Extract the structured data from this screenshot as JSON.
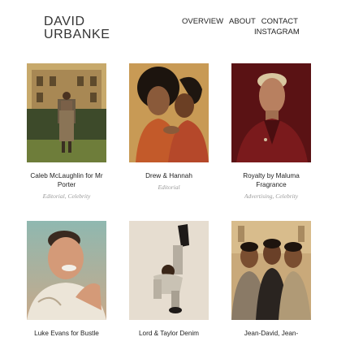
{
  "header": {
    "logo_line1": "DAVID",
    "logo_line2": "URBANKE"
  },
  "nav": {
    "overview": "OVERVIEW",
    "about": "ABOUT",
    "contact": "CONTACT",
    "instagram": "INSTAGRAM"
  },
  "projects": [
    {
      "title": "Caleb McLaughlin for Mr Porter",
      "tags": "Editorial, Celebrity"
    },
    {
      "title": "Drew & Hannah",
      "tags": "Editorial"
    },
    {
      "title": "Royalty by Maluma Fragrance",
      "tags": "Advertising, Celebrity"
    },
    {
      "title": "Luke Evans for Bustle",
      "tags": ""
    },
    {
      "title": "Lord & Taylor Denim",
      "tags": ""
    },
    {
      "title": "Jean-David, Jean-",
      "tags": ""
    }
  ],
  "colors": {
    "text": "#222222",
    "tags": "#9a9a9a",
    "background": "#ffffff"
  }
}
